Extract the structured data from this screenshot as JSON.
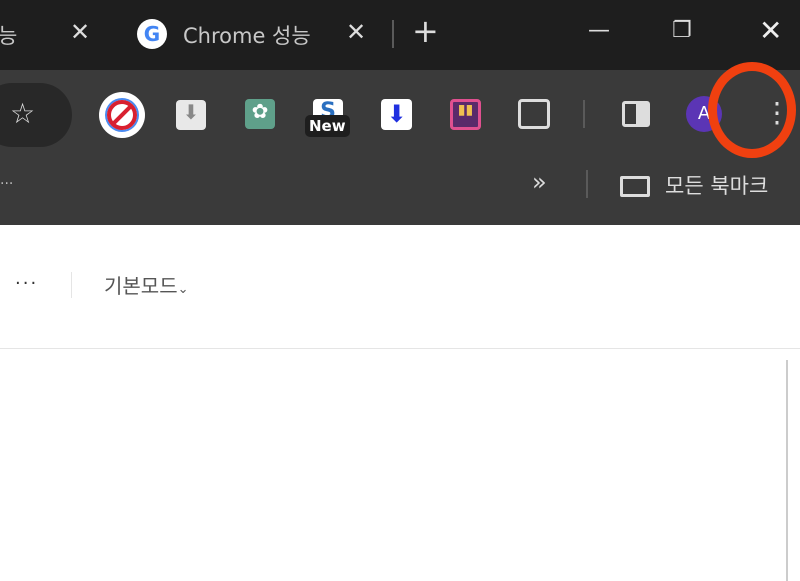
{
  "tabs": [
    {
      "label": "능",
      "close": "✕"
    },
    {
      "label": "Chrome 성능",
      "close": "✕",
      "favicon": "google-icon"
    }
  ],
  "new_tab": "+",
  "window_controls": {
    "minimize": "—",
    "restore": "❐",
    "close": "✕"
  },
  "extensions": [
    {
      "name": "block-icon"
    },
    {
      "name": "download-icon"
    },
    {
      "name": "chatgpt-icon"
    },
    {
      "name": "s-icon",
      "badge": "New"
    },
    {
      "name": "arrow-down-icon"
    },
    {
      "name": "chart-icon"
    }
  ],
  "avatar": "A",
  "menu": "⋮",
  "bookmarks": {
    "overflow": "»",
    "all_bookmarks": "모든 북마크",
    "left_more": "..."
  },
  "page": {
    "more": "···",
    "mode": "기본모드",
    "mode_chevron": "⌄"
  },
  "annotation_color": "#f04010"
}
